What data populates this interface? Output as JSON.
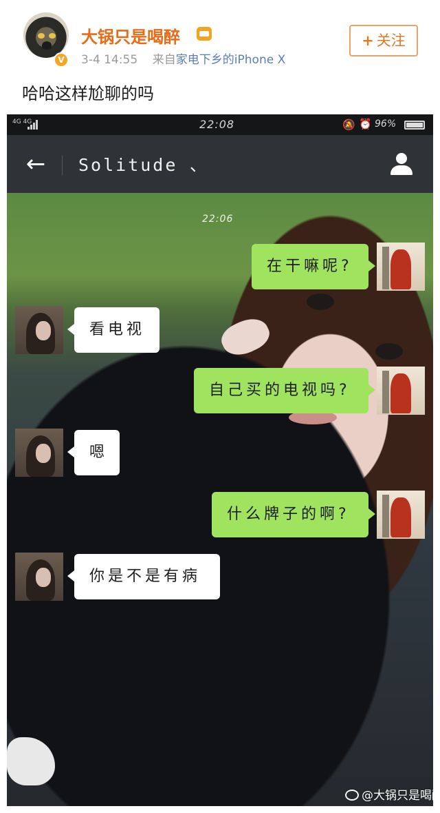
{
  "post": {
    "username": "大锅只是喝醉",
    "verified_badge": "V",
    "date": "3-4 14:55",
    "source_prefix": "来自",
    "source_app": "家电下乡的",
    "device": "iPhone X",
    "follow_label": "关注",
    "text": "哈哈这样尬聊的吗",
    "accent_color": "#e86b17",
    "icons": [
      "avatar",
      "vip-crown-icon",
      "plus-icon"
    ]
  },
  "screenshot": {
    "statusbar": {
      "network": "4G 4G",
      "time": "22:08",
      "battery_pct": "96%",
      "icons": [
        "signal-icon",
        "mute-bell-icon",
        "alarm-icon",
        "battery-icon"
      ]
    },
    "header": {
      "title": "Solitude ､",
      "icons": [
        "back-arrow-icon",
        "person-icon"
      ]
    },
    "chat_time": "22:06",
    "messages": [
      {
        "from": "me",
        "text": "在干嘛呢?"
      },
      {
        "from": "her",
        "text": "看电视"
      },
      {
        "from": "me",
        "text": "自己买的电视吗?"
      },
      {
        "from": "her",
        "text": "嗯"
      },
      {
        "from": "me",
        "text": "什么牌子的啊?"
      },
      {
        "from": "her",
        "text": "你是不是有病"
      }
    ],
    "bubble_colors": {
      "outgoing": "#9fe35f",
      "incoming": "#ffffff"
    },
    "watermark": "@大锅只是喝醉"
  }
}
